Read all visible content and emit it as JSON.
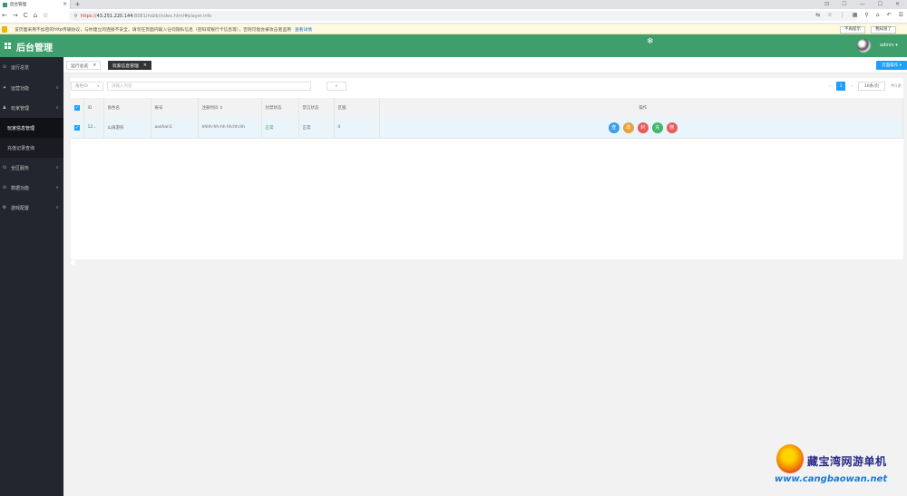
{
  "browser": {
    "tab_title": "后台管理",
    "url_protocol": "https://",
    "url_host": "43.251.220.144",
    "url_path": ":8081/hdzb/index.html#player.info",
    "nav": [
      "←",
      "→",
      "C",
      "⌂",
      "☆"
    ],
    "right_tools": [
      "⇆",
      "☆",
      "⋮",
      "▦",
      "⚲",
      "⌂",
      "↶",
      "☰"
    ],
    "window_controls": [
      "⊡",
      "☐",
      "—",
      "☐",
      "✕"
    ]
  },
  "infobar": {
    "text": "该页面采用不加密的http传输协议，与你建立的连接不安全。请勿在页面内输入任何隐私信息（密码或银行卡信息等），否则可能会被攻击者盗用",
    "link": "查看详情",
    "buttons": [
      "不再提示",
      "我知道了"
    ]
  },
  "header": {
    "title": "后台管理",
    "user": "admin ▾"
  },
  "sidebar": {
    "items": [
      {
        "icon": "⊙",
        "label": "运行总览",
        "chev": "",
        "type": "top"
      },
      {
        "icon": "✦",
        "label": "运营功能",
        "chev": "∨",
        "type": "top"
      },
      {
        "icon": "♟",
        "label": "玩家管理",
        "chev": "∧",
        "type": "top"
      },
      {
        "icon": "",
        "label": "玩家信息管理",
        "chev": "",
        "type": "sub-active"
      },
      {
        "icon": "",
        "label": "充值记录查询",
        "chev": "",
        "type": "sub"
      },
      {
        "icon": "⊙",
        "label": "全区服务",
        "chev": "∨",
        "type": "top"
      },
      {
        "icon": "⊙",
        "label": "数据功能",
        "chev": "∨",
        "type": "top"
      },
      {
        "icon": "⚙",
        "label": "游戏配置",
        "chev": "∨",
        "type": "top"
      }
    ]
  },
  "tabs": [
    {
      "label": "运行总览",
      "close": "×"
    },
    {
      "label": "玩家信息管理",
      "close": "×"
    }
  ],
  "action_button": "页面操作 ▾",
  "filter": {
    "select_value": "角色ID",
    "select_arrow": "∨",
    "search_placeholder": "请输入内容",
    "search_icon": "⌕"
  },
  "pager": {
    "prev": "‹",
    "current": "1",
    "next": "›",
    "page_size": "10条/页",
    "total": "共1条"
  },
  "table": {
    "headers": [
      "",
      "ID",
      "角色名",
      "账号",
      "注册时间 ⇕",
      "封禁状态",
      "禁言状态",
      "区服",
      "操作"
    ],
    "rows": [
      {
        "check": "✓",
        "id": "12...",
        "name": "山海游侠",
        "account": "aoshan1",
        "time": "hhhh-hh-hh hh:hh:hh",
        "ban": "正常",
        "mute": "正常",
        "server": "0"
      }
    ],
    "ops": [
      {
        "label": "查",
        "color": "#3b9ee8"
      },
      {
        "label": "改",
        "color": "#e8a13b"
      },
      {
        "label": "封",
        "color": "#e85a5a"
      },
      {
        "label": "充",
        "color": "#3fb868"
      },
      {
        "label": "删",
        "color": "#e85a5a"
      }
    ]
  },
  "watermark": {
    "cn": "藏宝湾网游单机",
    "en": "www.cangbaowan.net"
  }
}
